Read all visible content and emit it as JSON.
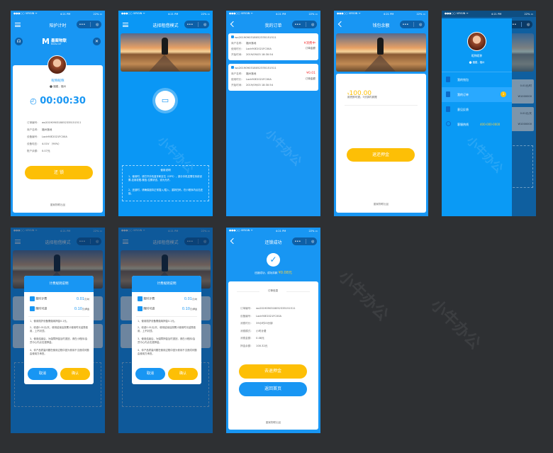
{
  "status": {
    "carrier": "●●●○○ VIRGIN ᯤ",
    "time": "4:21 PM",
    "battery": "22% ▭"
  },
  "capsule": {
    "more": "•••",
    "close": "◎"
  },
  "watermark": "小牛办公",
  "footer": "墨案物联出品",
  "screen1": {
    "title": "陪护计时",
    "logo_text": "墨案物联",
    "logo_sub": "MOOSA IOT",
    "name": "昵称昵称",
    "location": "福建，福州",
    "timer": "00:00:30",
    "rows": [
      {
        "k": "订单编号:",
        "v": "wx2019090318052335151511"
      },
      {
        "k": "商户名称:",
        "v": "福州落地"
      },
      {
        "k": "设备编号:",
        "v": "Lock90E2021FC00A"
      },
      {
        "k": "设备电压:",
        "v": "4.01V （90%）"
      },
      {
        "k": "账户余额:",
        "v": "0.07元"
      }
    ],
    "button": "还 锁"
  },
  "screen2": {
    "title": "选择租借模式",
    "instructions_title": "使用说明",
    "instructions": [
      "1、使用时，请打开手机蓝牙和定位（GPS），部分手机还需在系统设置-应用权限-微信-位置状态，设为允许。",
      "2、还锁时，请确保锁扣正常插入/插入，重新扫码，在小程序内点击还锁。"
    ]
  },
  "screen3": {
    "title": "我的订单",
    "orders": [
      {
        "id": "wx2019090318052335151511",
        "merchant_k": "商户名称:",
        "merchant": "福州落地",
        "device_k": "使用时长:",
        "device": "Lock90E2021FC00A",
        "time_k": "开始时间:",
        "time": "2019/09/03  18:30:54",
        "amount": "¥消费中",
        "amount_label": "订单金额"
      },
      {
        "id": "wx2019090318052335151511",
        "merchant_k": "商户名称:",
        "merchant": "福州落地",
        "device_k": "使用时长:",
        "device": "Lock90E2021FC00A",
        "time_k": "开始时间:",
        "time": "2019/09/03  18:30:54",
        "amount": "¥0.01",
        "amount_label": "订单金额"
      }
    ]
  },
  "screen4": {
    "title": "钱包余额",
    "currency": "¥",
    "amount": "100.00",
    "note": "用完即可退，5分钟内到账",
    "button": "退还押金"
  },
  "screen5": {
    "name": "昵称昵称",
    "location": "福建，福州",
    "items": [
      {
        "label": "我的钱包"
      },
      {
        "label": "我的订单",
        "badge": "1"
      },
      {
        "label": "意见反馈"
      },
      {
        "label": "客服热线",
        "extra": "400-000-0000"
      }
    ],
    "bg_price1": "0.01元/时",
    "bg_price2": "0.01元/天",
    "bg_code": "W1000000"
  },
  "modal": {
    "title": "选择租借模式",
    "heading": "计费规则说明",
    "options": [
      {
        "label": "按时计费",
        "price": "0.01",
        "unit": "元/时"
      },
      {
        "label": "随时可退",
        "price": "0.10",
        "unit": "元/押金"
      }
    ],
    "rules": [
      "1、使用陪护设备需缴纳押金0.1元。",
      "2、收费0.01元/天，使用结束后按累计使用时长结算费用，上不封顶。",
      "3、使用结束后，为保障押金及时退回，请在小程序/会员中心内点击退押金。",
      "4、你产品质量问题在使用过程中因为使用不当造成问题由使用方承担。"
    ],
    "cancel": "取消",
    "confirm": "确认"
  },
  "screen8": {
    "title": "还锁成功",
    "msg": "还锁成功，成功扣款",
    "amount": "¥0.08元",
    "section": "订单信息",
    "rows": [
      {
        "k": "订单编号:",
        "v": "wx2019090318052335151511"
      },
      {
        "k": "设备编号:",
        "v": "Lock90E2021FC00A"
      },
      {
        "k": "消费时长:",
        "v": "39小时23分钟"
      },
      {
        "k": "消费模式:",
        "v": "小时计费"
      },
      {
        "k": "消费金额:",
        "v": "0.08元"
      },
      {
        "k": "押金余额:",
        "v": "100.32元"
      }
    ],
    "btn1": "去退押金",
    "btn2": "返回首页"
  },
  "colors": {
    "primary": "#1896f3",
    "accent": "#fdbf06",
    "danger": "#f23a3a",
    "background": "#2e3033"
  }
}
